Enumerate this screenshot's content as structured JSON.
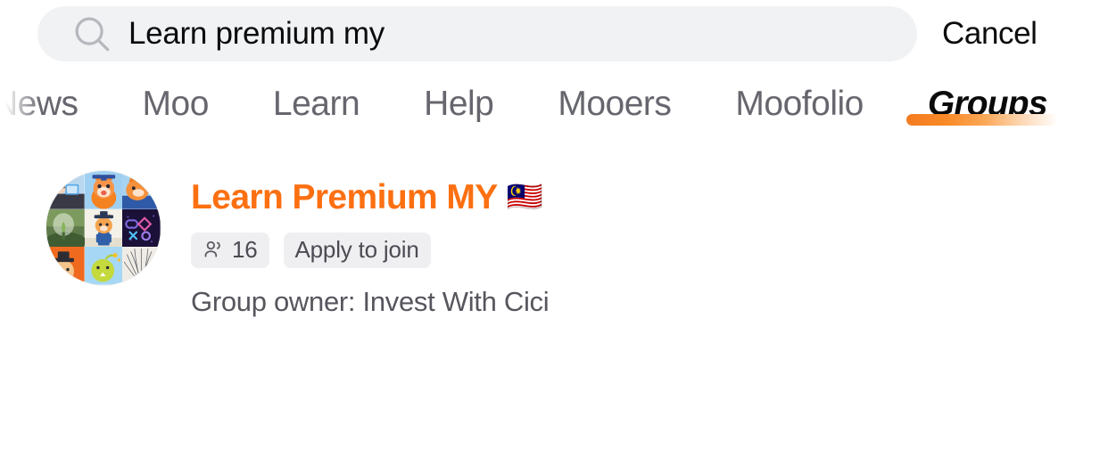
{
  "search": {
    "value": "Learn premium my",
    "placeholder": "Search",
    "icon": "search-icon",
    "cancel_label": "Cancel"
  },
  "tabs": {
    "items": [
      {
        "label": "News",
        "active": false,
        "truncated": true
      },
      {
        "label": "Moo",
        "active": false
      },
      {
        "label": "Learn",
        "active": false
      },
      {
        "label": "Help",
        "active": false
      },
      {
        "label": "Mooers",
        "active": false
      },
      {
        "label": "Moofolio",
        "active": false
      },
      {
        "label": "Groups",
        "active": true
      }
    ],
    "active_label": "Groups"
  },
  "results": [
    {
      "title": "Learn Premium MY",
      "flag": "🇲🇾",
      "avatar_icon": "group-avatar-collage",
      "members_icon": "members-icon",
      "members_count": "16",
      "join_label": "Apply to join",
      "owner_line": "Group owner: Invest With Cici"
    }
  ],
  "colors": {
    "accent_orange": "#FC7012",
    "underline_start": "#F47B20",
    "underline_end": "#FFFFFF",
    "field_bg": "#F1F2F4",
    "badge_bg": "#EFEFF1",
    "tab_inactive": "#66666E",
    "tab_active": "#0A0A0B",
    "text_primary": "#0C0C0D",
    "text_secondary": "#56565E"
  }
}
